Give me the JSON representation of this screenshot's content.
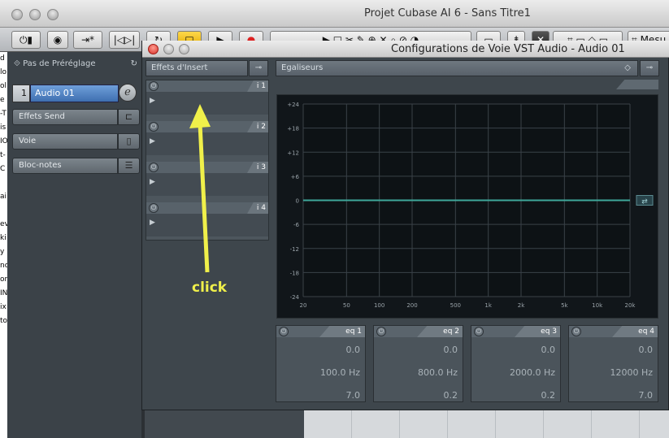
{
  "app": {
    "title": "Projet Cubase AI 6 - Sans Titre1",
    "menu_label": "Mesu"
  },
  "inspector": {
    "preset_label": "Pas de Préréglage",
    "track_number": "1",
    "track_name": "Audio 01",
    "items": [
      {
        "label": "Effets Send"
      },
      {
        "label": "Voie"
      },
      {
        "label": "Bloc-notes"
      }
    ],
    "edge_letters": [
      "d",
      "lo",
      "ol",
      "e",
      "-T",
      "is",
      "IOS",
      "t-",
      "C",
      "",
      "ai",
      "",
      "ev",
      "ki",
      "y",
      "no",
      "or",
      "INI",
      "ix",
      "to"
    ]
  },
  "vst_window": {
    "title": "Configurations de Voie VST Audio - Audio 01",
    "inserts_header": "Effets d'Insert",
    "eq_header": "Egaliseurs",
    "insert_slots": [
      {
        "label": "i 1"
      },
      {
        "label": "i 2"
      },
      {
        "label": "i 3"
      },
      {
        "label": "i 4"
      }
    ]
  },
  "chart_data": {
    "type": "line",
    "title": "",
    "xlabel": "",
    "ylabel": "",
    "x_scale": "log",
    "xlim": [
      20,
      20000
    ],
    "ylim": [
      -24,
      24
    ],
    "x_ticks": [
      {
        "value": 20,
        "label": "20"
      },
      {
        "value": 50,
        "label": "50"
      },
      {
        "value": 100,
        "label": "100"
      },
      {
        "value": 200,
        "label": "200"
      },
      {
        "value": 500,
        "label": "500"
      },
      {
        "value": 1000,
        "label": "1k"
      },
      {
        "value": 2000,
        "label": "2k"
      },
      {
        "value": 5000,
        "label": "5k"
      },
      {
        "value": 10000,
        "label": "10k"
      },
      {
        "value": 20000,
        "label": "20k"
      }
    ],
    "y_ticks": [
      {
        "value": 24,
        "label": "+24"
      },
      {
        "value": 18,
        "label": "+18"
      },
      {
        "value": 12,
        "label": "+12"
      },
      {
        "value": 6,
        "label": "+6"
      },
      {
        "value": 0,
        "label": "0"
      },
      {
        "value": -6,
        "label": "-6"
      },
      {
        "value": -12,
        "label": "-12"
      },
      {
        "value": -18,
        "label": "-18"
      },
      {
        "value": -24,
        "label": "-24"
      }
    ],
    "grid": true,
    "series": [
      {
        "x": [
          20,
          20000
        ],
        "y": [
          0,
          0
        ],
        "color": "#3fa89a"
      }
    ]
  },
  "eq_bands": [
    {
      "label": "eq 1",
      "gain": "0.0",
      "freq": "100.0 Hz",
      "q": "7.0"
    },
    {
      "label": "eq 2",
      "gain": "0.0",
      "freq": "800.0 Hz",
      "q": "0.2"
    },
    {
      "label": "eq 3",
      "gain": "0.0",
      "freq": "2000.0 Hz",
      "q": "0.2"
    },
    {
      "label": "eq 4",
      "gain": "0.0",
      "freq": "12000 Hz",
      "q": "7.0"
    }
  ],
  "annotation": {
    "text": "click",
    "color": "#f0f04a"
  }
}
